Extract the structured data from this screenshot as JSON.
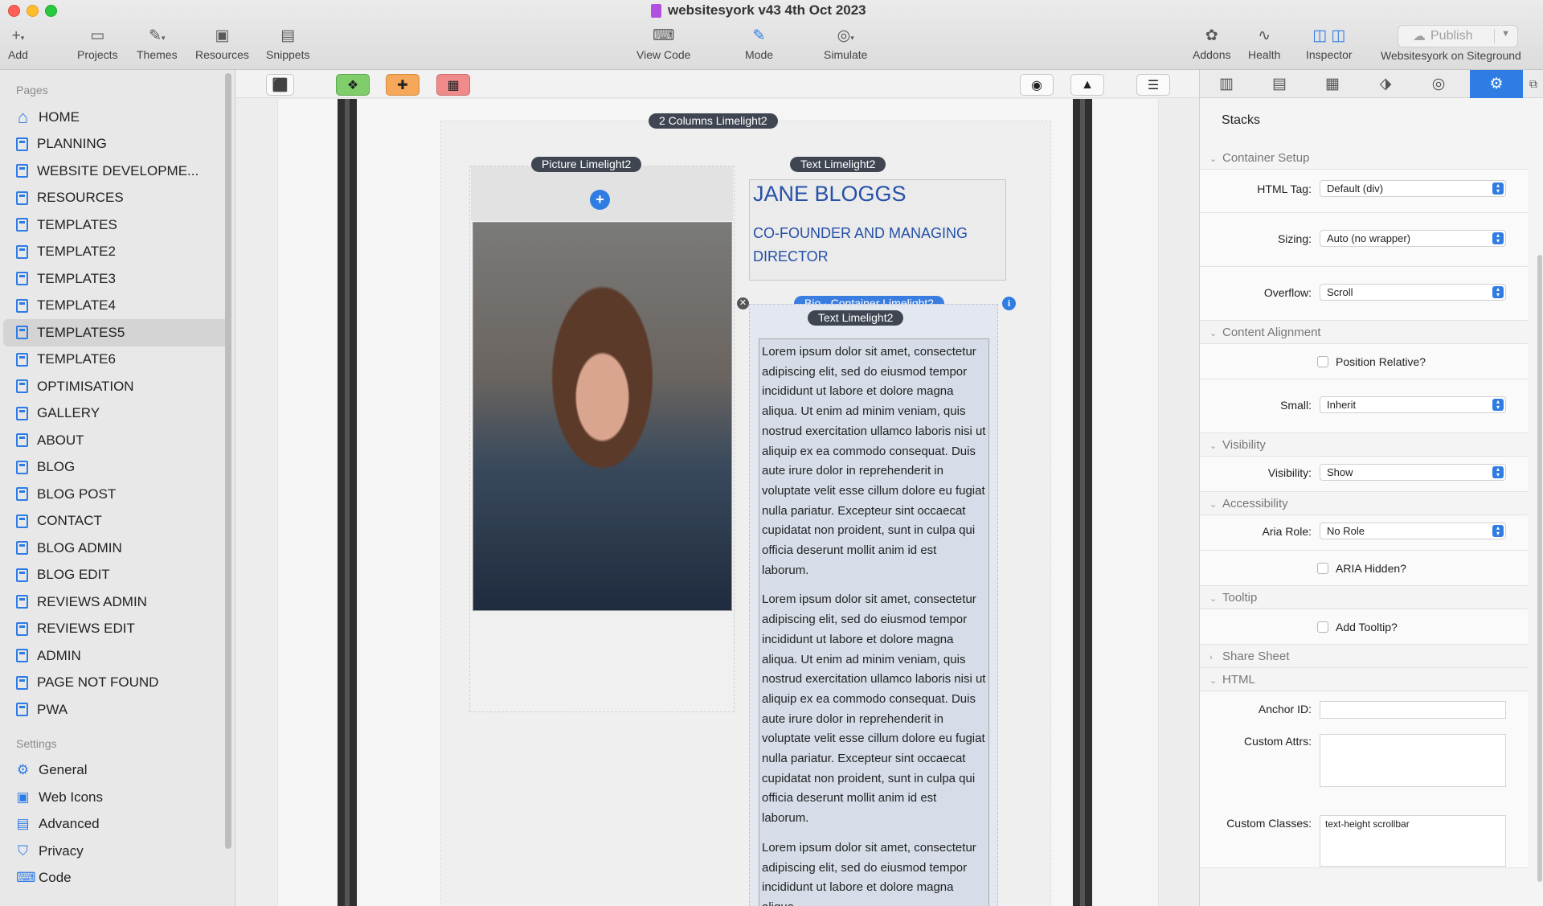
{
  "window": {
    "title": "websitesyork v43 4th Oct 2023"
  },
  "toolbar": {
    "add": "Add",
    "projects": "Projects",
    "themes": "Themes",
    "resources": "Resources",
    "snippets": "Snippets",
    "view_code": "View Code",
    "mode": "Mode",
    "simulate": "Simulate",
    "addons": "Addons",
    "health": "Health",
    "inspector": "Inspector",
    "publish_target": "Websitesyork on Siteground",
    "publish": "Publish"
  },
  "sidebar": {
    "pages_heading": "Pages",
    "pages": [
      {
        "label": "HOME",
        "icon": "home-icon"
      },
      {
        "label": "PLANNING",
        "icon": "page-icon"
      },
      {
        "label": "WEBSITE  DEVELOPME...",
        "icon": "page-icon"
      },
      {
        "label": "RESOURCES",
        "icon": "page-icon"
      },
      {
        "label": "TEMPLATES",
        "icon": "page-icon"
      },
      {
        "label": "TEMPLATE2",
        "icon": "page-icon"
      },
      {
        "label": "TEMPLATE3",
        "icon": "page-icon"
      },
      {
        "label": "TEMPLATE4",
        "icon": "page-icon"
      },
      {
        "label": "TEMPLATES5",
        "icon": "page-icon",
        "selected": true
      },
      {
        "label": "TEMPLATE6",
        "icon": "page-icon"
      },
      {
        "label": "OPTIMISATION",
        "icon": "page-icon"
      },
      {
        "label": "GALLERY",
        "icon": "page-icon"
      },
      {
        "label": "ABOUT",
        "icon": "page-icon"
      },
      {
        "label": "BLOG",
        "icon": "page-icon"
      },
      {
        "label": "BLOG POST",
        "icon": "page-icon"
      },
      {
        "label": "CONTACT",
        "icon": "page-icon"
      },
      {
        "label": "BLOG ADMIN",
        "icon": "page-icon"
      },
      {
        "label": "BLOG EDIT",
        "icon": "page-icon"
      },
      {
        "label": "REVIEWS ADMIN",
        "icon": "page-icon"
      },
      {
        "label": "REVIEWS EDIT",
        "icon": "page-icon"
      },
      {
        "label": "ADMIN",
        "icon": "page-icon"
      },
      {
        "label": "PAGE NOT FOUND",
        "icon": "page-icon"
      },
      {
        "label": "PWA",
        "icon": "page-icon"
      }
    ],
    "settings_heading": "Settings",
    "settings": [
      {
        "label": "General",
        "icon": "gear-icon"
      },
      {
        "label": "Web Icons",
        "icon": "image-icon"
      },
      {
        "label": "Advanced",
        "icon": "sliders-icon"
      },
      {
        "label": "Privacy",
        "icon": "shield-icon"
      },
      {
        "label": "Code",
        "icon": "code-icon"
      }
    ]
  },
  "canvas": {
    "columns_tag": "2 Columns  Limelight2",
    "picture_tag": "Picture  Limelight2",
    "text_tag": "Text  Limelight2",
    "bio_tag": "Bio ·  Container  Limelight2",
    "bio_text_tag": "Text  Limelight2",
    "name": "JANE BLOGGS",
    "role": "CO-FOUNDER AND MANAGING DIRECTOR",
    "bio_paragraphs": [
      "Lorem ipsum dolor sit amet, consectetur adipiscing elit, sed do eiusmod tempor incididunt ut labore et dolore magna aliqua. Ut enim ad minim veniam, quis nostrud exercitation ullamco laboris nisi ut aliquip ex ea commodo consequat. Duis aute irure dolor in reprehenderit in voluptate velit esse cillum dolore eu fugiat nulla pariatur. Excepteur sint occaecat cupidatat non proident, sunt in culpa qui officia deserunt mollit anim id est laborum.",
      "Lorem ipsum dolor sit amet, consectetur adipiscing elit, sed do eiusmod tempor incididunt ut labore et dolore magna aliqua. Ut enim ad minim veniam, quis nostrud exercitation ullamco laboris nisi ut aliquip ex ea commodo consequat. Duis aute irure dolor in reprehenderit in voluptate velit esse cillum dolore eu fugiat nulla pariatur. Excepteur sint occaecat cupidatat non proident, sunt in culpa qui officia deserunt mollit anim id est laborum.",
      "Lorem ipsum dolor sit amet, consectetur adipiscing elit, sed do eiusmod tempor incididunt ut labore et dolore magna aliqua."
    ]
  },
  "inspector": {
    "title": "Stacks",
    "sections": {
      "container_setup": "Container Setup",
      "content_alignment": "Content Alignment",
      "visibility": "Visibility",
      "accessibility": "Accessibility",
      "tooltip": "Tooltip",
      "share_sheet": "Share Sheet",
      "html": "HTML"
    },
    "fields": {
      "html_tag_label": "HTML Tag:",
      "html_tag_value": "Default (div)",
      "sizing_label": "Sizing:",
      "sizing_value": "Auto (no wrapper)",
      "overflow_label": "Overflow:",
      "overflow_value": "Scroll",
      "position_relative": "Position Relative?",
      "small_label": "Small:",
      "small_value": "Inherit",
      "visibility_label": "Visibility:",
      "visibility_value": "Show",
      "aria_role_label": "Aria Role:",
      "aria_role_value": "No Role",
      "aria_hidden": "ARIA Hidden?",
      "add_tooltip": "Add Tooltip?",
      "anchor_id_label": "Anchor ID:",
      "anchor_id_value": "",
      "custom_attrs_label": "Custom Attrs:",
      "custom_attrs_value": "",
      "custom_classes_label": "Custom Classes:",
      "custom_classes_value": "text-height scrollbar"
    }
  },
  "colors": {
    "accent": "#2f7de3",
    "heading_text": "#2450a8",
    "tag_bg": "#3f4652"
  }
}
